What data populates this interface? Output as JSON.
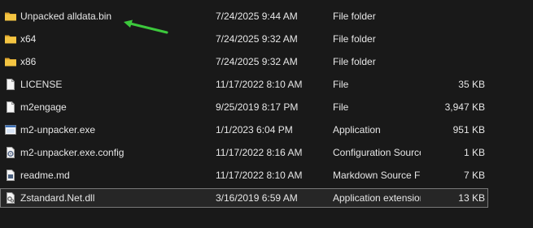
{
  "files": [
    {
      "name": "Unpacked alldata.bin",
      "date": "7/24/2025 9:44 AM",
      "type": "File folder",
      "size": "",
      "icon": "folder-icon"
    },
    {
      "name": "x64",
      "date": "7/24/2025 9:32 AM",
      "type": "File folder",
      "size": "",
      "icon": "folder-icon"
    },
    {
      "name": "x86",
      "date": "7/24/2025 9:32 AM",
      "type": "File folder",
      "size": "",
      "icon": "folder-icon"
    },
    {
      "name": "LICENSE",
      "date": "11/17/2022 8:10 AM",
      "type": "File",
      "size": "35 KB",
      "icon": "generic-file-icon"
    },
    {
      "name": "m2engage",
      "date": "9/25/2019 8:17 PM",
      "type": "File",
      "size": "3,947 KB",
      "icon": "generic-file-icon"
    },
    {
      "name": "m2-unpacker.exe",
      "date": "1/1/2023 6:04 PM",
      "type": "Application",
      "size": "951 KB",
      "icon": "application-icon"
    },
    {
      "name": "m2-unpacker.exe.config",
      "date": "11/17/2022 8:16 AM",
      "type": "Configuration Source File",
      "size": "1 KB",
      "icon": "config-file-icon"
    },
    {
      "name": "readme.md",
      "date": "11/17/2022 8:10 AM",
      "type": "Markdown Source File",
      "size": "7 KB",
      "icon": "markdown-file-icon"
    },
    {
      "name": "Zstandard.Net.dll",
      "date": "3/16/2019 6:59 AM",
      "type": "Application extension",
      "size": "13 KB",
      "icon": "dll-file-icon",
      "selected": true
    }
  ],
  "annotation": {
    "arrow_color": "#3cc83c"
  },
  "colors": {
    "background": "#191919",
    "text": "#e6e6e6",
    "folder": "#f4c542",
    "selection_border": "#7a7a7a"
  }
}
